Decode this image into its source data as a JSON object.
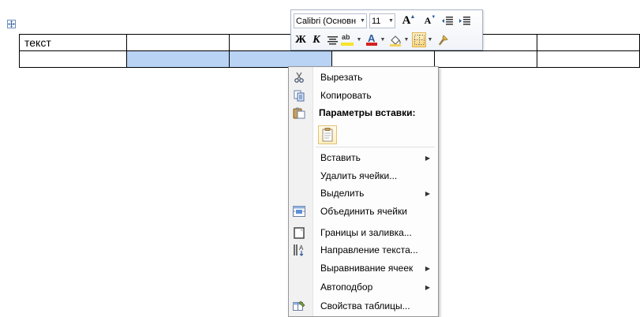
{
  "table": {
    "rows": [
      [
        "текст",
        "",
        "",
        "",
        "",
        ""
      ],
      [
        "",
        "",
        "",
        "",
        "",
        ""
      ]
    ]
  },
  "mini_toolbar": {
    "font_name": "Calibri (Основн",
    "font_size": "11",
    "grow_font_glyph": "A",
    "shrink_font_glyph": "A",
    "bold_glyph": "Ж",
    "italic_glyph": "К",
    "font_color_glyph": "A",
    "highlight_glyph": "ab",
    "colors": {
      "highlight": "#f7e32b",
      "font_color": "#d42020",
      "accent": "#f8c64f"
    }
  },
  "context_menu": {
    "items": [
      {
        "label": "Вырезать",
        "icon": "scissors-icon"
      },
      {
        "label": "Копировать",
        "icon": "copy-icon"
      },
      {
        "label": "Параметры вставки:",
        "icon": "paste-icon"
      },
      {
        "label": "Вставить",
        "submenu": true
      },
      {
        "label": "Удалить ячейки..."
      },
      {
        "label": "Выделить",
        "submenu": true
      },
      {
        "label": "Объединить ячейки",
        "icon": "merge-cells-icon"
      },
      {
        "label": "Границы и заливка...",
        "icon": "borders-icon"
      },
      {
        "label": "Направление текста...",
        "icon": "text-direction-icon"
      },
      {
        "label": "Выравнивание ячеек",
        "submenu": true
      },
      {
        "label": "Автоподбор",
        "submenu": true
      },
      {
        "label": "Свойства таблицы...",
        "icon": "table-properties-icon"
      }
    ],
    "submenu_arrow": "▶"
  }
}
